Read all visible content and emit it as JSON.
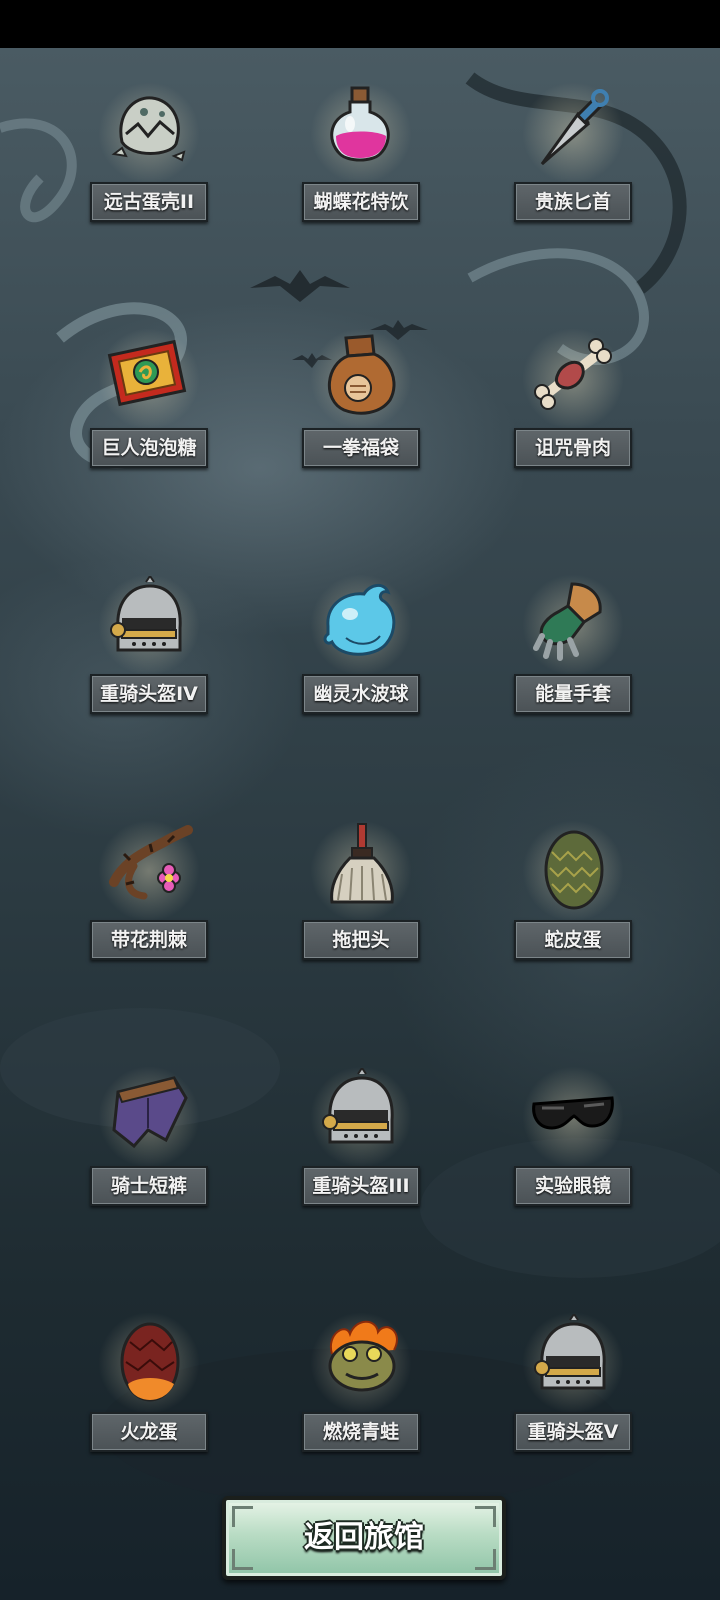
{
  "items": [
    {
      "name": "远古蛋壳II",
      "icon": "ancient-eggshell-icon"
    },
    {
      "name": "蝴蝶花特饮",
      "icon": "pink-potion-icon"
    },
    {
      "name": "贵族匕首",
      "icon": "noble-dagger-icon"
    },
    {
      "name": "巨人泡泡糖",
      "icon": "bubble-gum-pack-icon"
    },
    {
      "name": "一拳福袋",
      "icon": "fist-lucky-bag-icon"
    },
    {
      "name": "诅咒骨肉",
      "icon": "cursed-bone-meat-icon"
    },
    {
      "name": "重骑头盔IV",
      "icon": "heavy-knight-helmet-icon"
    },
    {
      "name": "幽灵水波球",
      "icon": "ghost-water-ball-icon"
    },
    {
      "name": "能量手套",
      "icon": "energy-gauntlet-icon"
    },
    {
      "name": "带花荆棘",
      "icon": "flowered-thorn-icon"
    },
    {
      "name": "拖把头",
      "icon": "mop-head-icon"
    },
    {
      "name": "蛇皮蛋",
      "icon": "snakeskin-egg-icon"
    },
    {
      "name": "骑士短裤",
      "icon": "knight-shorts-icon"
    },
    {
      "name": "重骑头盔III",
      "icon": "heavy-knight-helmet-icon"
    },
    {
      "name": "实验眼镜",
      "icon": "lab-goggles-icon"
    },
    {
      "name": "火龙蛋",
      "icon": "fire-dragon-egg-icon"
    },
    {
      "name": "燃烧青蛙",
      "icon": "burning-frog-icon"
    },
    {
      "name": "重骑头盔V",
      "icon": "heavy-knight-helmet-icon"
    }
  ],
  "back_button": {
    "label": "返回旅馆"
  }
}
